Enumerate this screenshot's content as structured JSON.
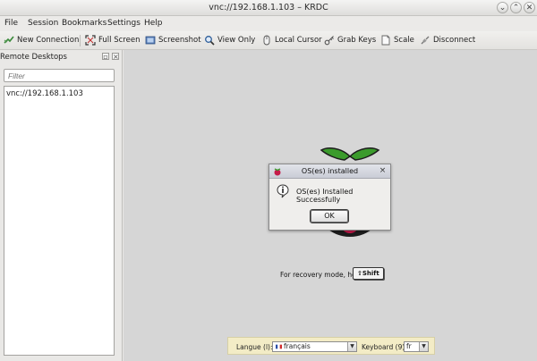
{
  "window": {
    "title": "vnc://192.168.1.103 – KRDC",
    "minimize": "⌄",
    "maximize": "⌃",
    "close": "✕"
  },
  "menu": [
    "File",
    "Session",
    "Bookmarks",
    "Settings",
    "Help"
  ],
  "toolbar": {
    "new_connection": "New Connection",
    "full_screen": "Full Screen",
    "screenshot": "Screenshot",
    "view_only": "View Only",
    "local_cursor": "Local Cursor",
    "grab_keys": "Grab Keys",
    "scale": "Scale",
    "disconnect": "Disconnect"
  },
  "sidebar": {
    "title": "Remote Desktops",
    "filter_placeholder": "Filter",
    "items": [
      "vnc://192.168.1.103"
    ]
  },
  "dialog": {
    "title": "OS(es) installed",
    "message": "OS(es) Installed Successfully",
    "ok": "OK"
  },
  "recovery": {
    "text": "For recovery mode, hold",
    "key": "⇧Shift"
  },
  "language_bar": {
    "language_label": "Langue (l):",
    "language_value": "français",
    "keyboard_label": "Keyboard (9):",
    "keyboard_value": "fr"
  },
  "colors": {
    "raspberry_red": "#c51a4a",
    "leaf_green": "#3b9b2c",
    "viewport_bg": "#d6d6d6",
    "langbar_bg": "#f3ecc6"
  }
}
